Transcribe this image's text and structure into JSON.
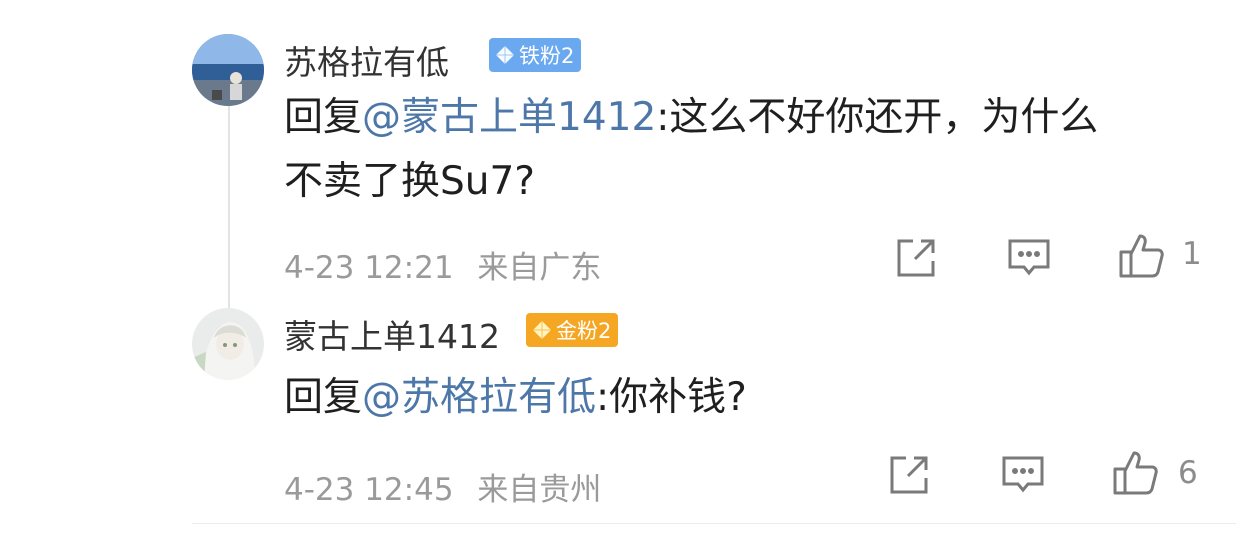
{
  "comments": [
    {
      "author": "苏格拉有低",
      "badge": "铁粉2",
      "reply_prefix": "回复",
      "mention": "@蒙古上单1412",
      "text_line1": ":这么不好你还开，为什么",
      "text_line2": "不卖了换Su7?",
      "time": "4-23 12:21",
      "location": "来自广东",
      "likes": "1"
    },
    {
      "author": "蒙古上单1412",
      "badge": "金粉2",
      "reply_prefix": "回复",
      "mention": "@苏格拉有低",
      "text_line1": ":你补钱?",
      "time": "4-23 12:45",
      "location": "来自贵州",
      "likes": "6"
    }
  ],
  "icons": {
    "forward": "share-icon",
    "reply": "comment-icon",
    "like": "thumbs-up-icon",
    "badge_gem": "diamond-icon"
  },
  "colors": {
    "mention": "#4d77a8",
    "iron_badge": "#6aa8f0",
    "gold_badge": "#f5a623",
    "meta": "#9a9a9a"
  }
}
